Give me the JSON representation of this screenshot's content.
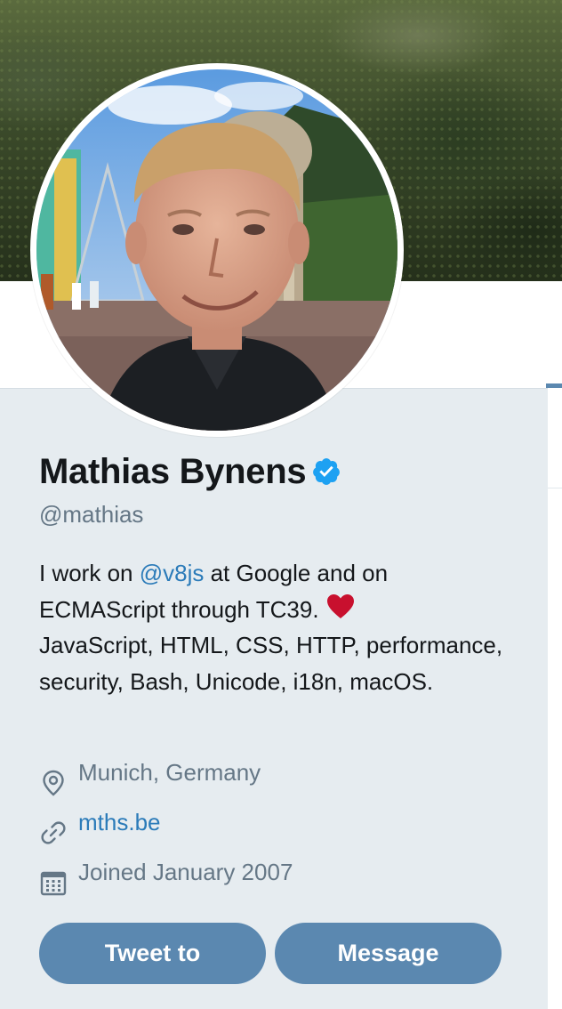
{
  "profile": {
    "name": "Mathias Bynens",
    "handle": "@mathias",
    "bio": {
      "part1": "I work on ",
      "mention": "@v8js",
      "part2": " at Google and on ECMAScript through TC39.",
      "line2": "JavaScript, HTML, CSS, HTTP, performance, security, Bash, Unicode, i18n, macOS."
    },
    "location": "Munich, Germany",
    "website": "mths.be",
    "joined": "Joined January 2007"
  },
  "actions": {
    "tweet_to": "Tweet to",
    "message": "Message"
  },
  "icons": {
    "verified": "verified-badge-icon",
    "heart": "red-heart-emoji",
    "location": "location-pin-icon",
    "link": "link-icon",
    "calendar": "calendar-icon"
  },
  "colors": {
    "accent": "#2b7bb9",
    "button": "#5b88b0",
    "card_bg": "#e6ecf0",
    "muted_text": "#657786",
    "verified": "#1da1f2",
    "heart": "#c8102e"
  }
}
